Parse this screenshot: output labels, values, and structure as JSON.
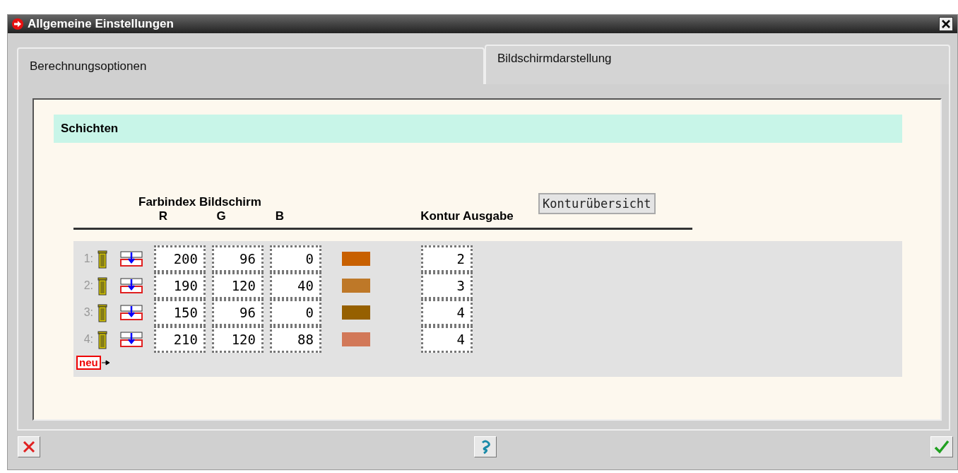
{
  "window": {
    "title": "Allgemeine Einstellungen"
  },
  "tabs": [
    {
      "label": "Berechnungsoptionen",
      "selected": false
    },
    {
      "label": "Bildschirmdarstellung",
      "selected": true
    }
  ],
  "section": {
    "title": "Schichten"
  },
  "table": {
    "group_heading": "Farbindex Bildschirm",
    "columns": [
      "R",
      "G",
      "B",
      "Kontur Ausgabe"
    ],
    "overview_button": "Konturübersicht",
    "rows": [
      {
        "number": "1:",
        "r": "200",
        "g": "96",
        "b": "0",
        "color": "#c86000",
        "contour": "2"
      },
      {
        "number": "2:",
        "r": "190",
        "g": "120",
        "b": "40",
        "color": "#be7828",
        "contour": "3"
      },
      {
        "number": "3:",
        "r": "150",
        "g": "96",
        "b": "0",
        "color": "#966000",
        "contour": "4"
      },
      {
        "number": "4:",
        "r": "210",
        "g": "120",
        "b": "88",
        "color": "#d27858",
        "contour": "4"
      }
    ],
    "new_button": "neu"
  }
}
